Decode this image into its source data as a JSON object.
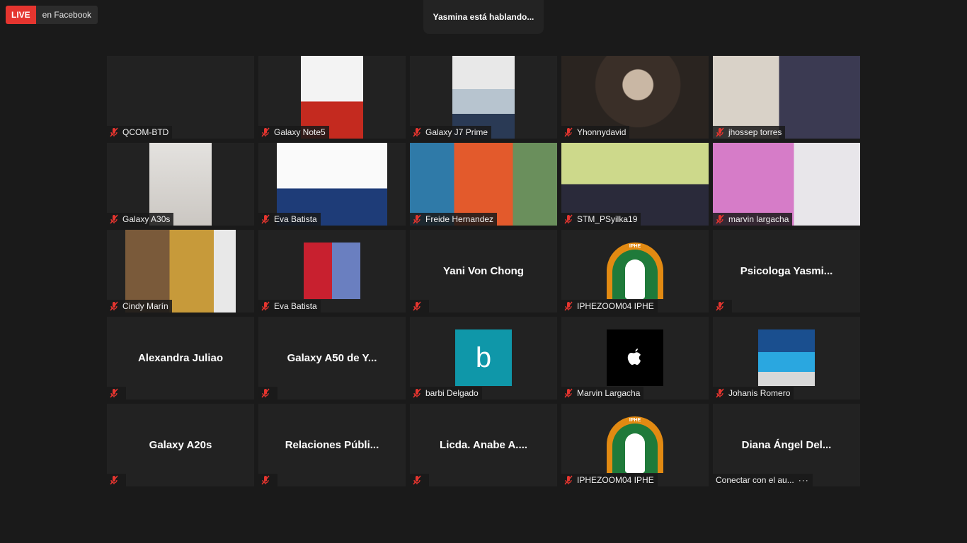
{
  "live": {
    "badge": "LIVE",
    "platform": "en Facebook"
  },
  "speaking": "Yasmina está hablando...",
  "participants": [
    {
      "label": "QCOM-BTD"
    },
    {
      "label": "Galaxy Note5"
    },
    {
      "label": "Galaxy J7 Prime"
    },
    {
      "label": "Yhonnydavid"
    },
    {
      "label": "jhossep torres"
    },
    {
      "label": "Galaxy A30s"
    },
    {
      "label": "Eva Batista"
    },
    {
      "label": "Freide Hernandez"
    },
    {
      "label": "STM_PSyilka19"
    },
    {
      "label": "marvin largacha"
    },
    {
      "label": "Cindy Marín"
    },
    {
      "label": "Eva Batista"
    },
    {
      "display": "Yani Von Chong"
    },
    {
      "label": "IPHEZOOM04 IPHE",
      "logo": "IPHE"
    },
    {
      "display": "Psicologa  Yasmi..."
    },
    {
      "display": "Alexandra Juliao"
    },
    {
      "display": "Galaxy A50 de Y..."
    },
    {
      "label": "barbi Delgado",
      "avatar_letter": "b"
    },
    {
      "label": "Marvin Largacha"
    },
    {
      "label": "Johanis Romero"
    },
    {
      "display": "Galaxy A20s"
    },
    {
      "display": "Relaciones  Públi..."
    },
    {
      "display": "Licda.  Anabe A...."
    },
    {
      "label": "IPHEZOOM04 IPHE",
      "logo": "IPHE"
    },
    {
      "display": "Diana  Ángel  Del...",
      "label": "Conectar con el au...",
      "more": "···"
    }
  ],
  "colors": {
    "live_red": "#e5352f",
    "mic_muted": "#e5352f",
    "tile_bg": "#222222"
  }
}
